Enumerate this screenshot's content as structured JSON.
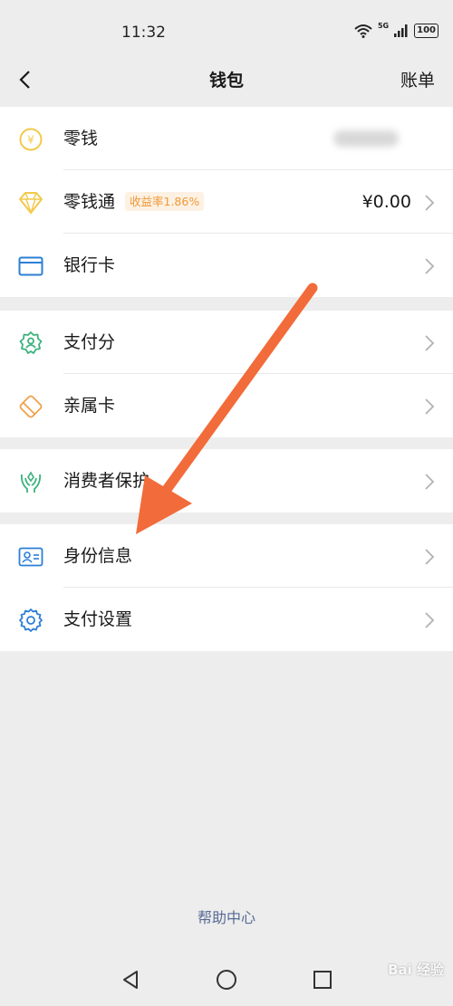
{
  "status_bar": {
    "time": "11:32",
    "network": "5G",
    "battery": "100"
  },
  "nav": {
    "title": "钱包",
    "right_label": "账单"
  },
  "group1": [
    {
      "label": "零钱"
    },
    {
      "label": "零钱通",
      "badge": "收益率1.86%",
      "value": "¥0.00"
    },
    {
      "label": "银行卡"
    }
  ],
  "group2": [
    {
      "label": "支付分"
    },
    {
      "label": "亲属卡"
    }
  ],
  "group3": [
    {
      "label": "消费者保护"
    }
  ],
  "group4": [
    {
      "label": "身份信息"
    },
    {
      "label": "支付设置"
    }
  ],
  "footer": {
    "help": "帮助中心"
  },
  "watermark": "Bai 经验",
  "colors": {
    "link": "#576b95",
    "badge_text": "#f09a38",
    "badge_bg": "#fdf1e3",
    "arrow": "#f26b3a",
    "coin": "#f2c94c"
  }
}
